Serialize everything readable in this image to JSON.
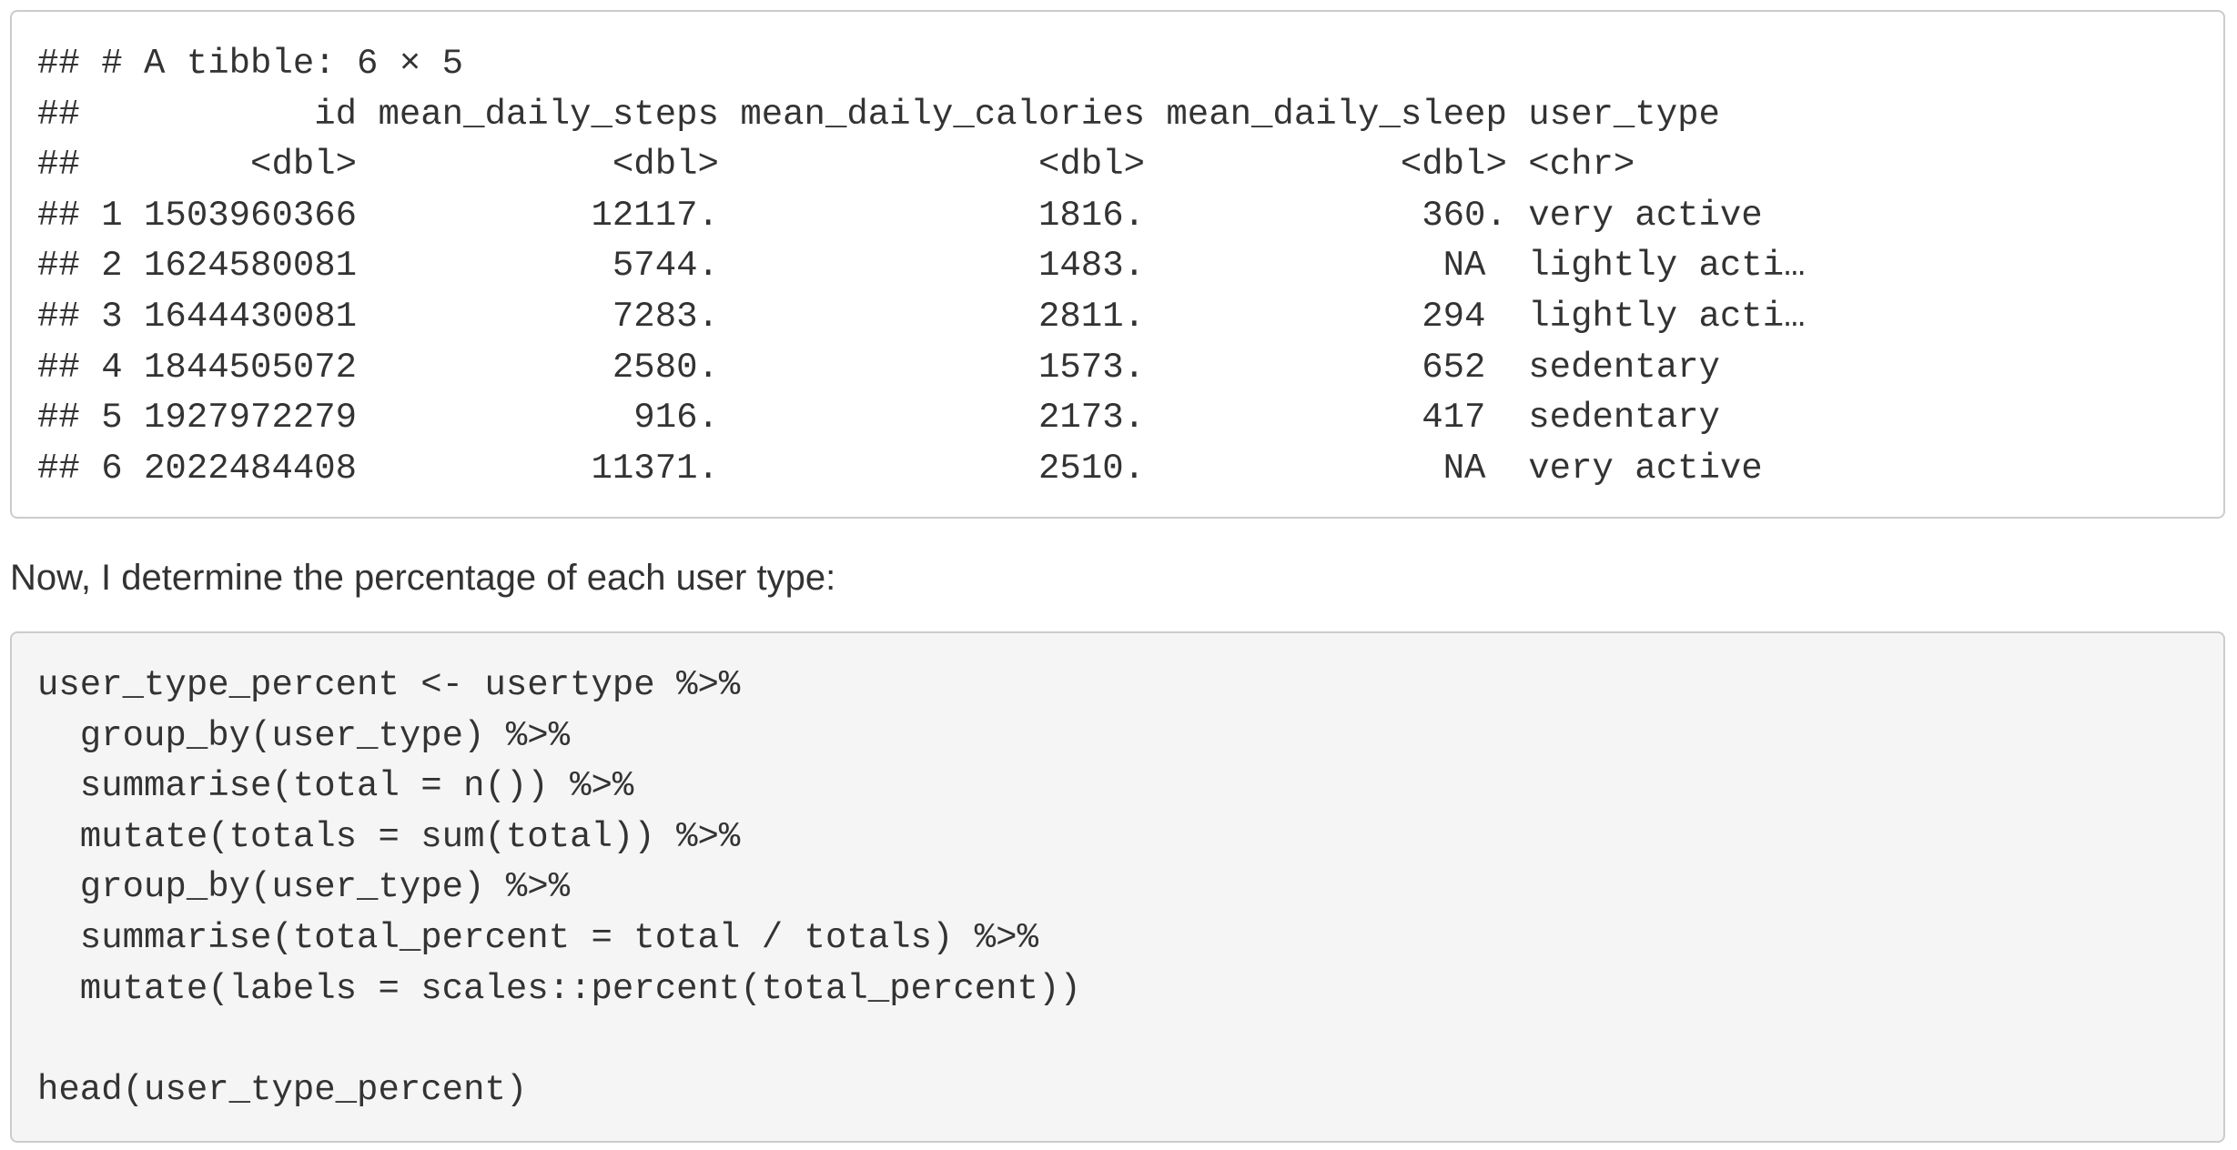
{
  "output_block": {
    "lines": [
      "## # A tibble: 6 × 5",
      "##           id mean_daily_steps mean_daily_calories mean_daily_sleep user_type",
      "##        <dbl>            <dbl>               <dbl>            <dbl> <chr>",
      "## 1 1503960366           12117.               1816.             360. very active",
      "## 2 1624580081            5744.               1483.              NA  lightly acti…",
      "## 3 1644430081            7283.               2811.             294  lightly acti…",
      "## 4 1844505072            2580.               1573.             652  sedentary",
      "## 5 1927972279             916.               2173.             417  sedentary",
      "## 6 2022484408           11371.               2510.              NA  very active"
    ]
  },
  "paragraph": "Now, I determine the percentage of each user type:",
  "code_block": {
    "lines": [
      "user_type_percent <- usertype %>%",
      "  group_by(user_type) %>%",
      "  summarise(total = n()) %>%",
      "  mutate(totals = sum(total)) %>%",
      "  group_by(user_type) %>%",
      "  summarise(total_percent = total / totals) %>%",
      "  mutate(labels = scales::percent(total_percent))",
      "",
      "head(user_type_percent)"
    ]
  }
}
